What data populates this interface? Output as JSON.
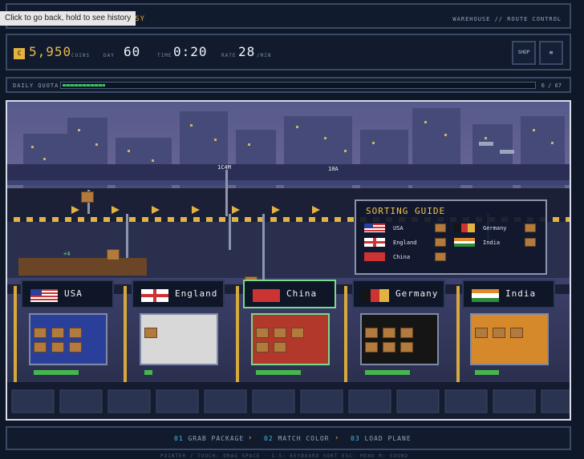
{
  "tooltip": "Click to go back, hold to see history",
  "brand": "RENSY",
  "breadcrumb": "WAREHOUSE // ROUTE CONTROL",
  "stats": {
    "coin_icon": "C",
    "coins": "5,950",
    "coins_label": "COINS",
    "day_label": "DAY",
    "day": "60",
    "time_label": "TIME",
    "time": "0:20",
    "rate_label": "RATE",
    "rate": "28",
    "rate_unit": "/MIN",
    "shop_label": "SHOP",
    "menu_label": "≡"
  },
  "quota": {
    "label": "DAILY QUOTA",
    "done": 6,
    "total": 67,
    "count_text": "6 / 67",
    "fraction": 0.0896
  },
  "scene": {
    "price_tags": [
      "1C4M",
      "10A"
    ],
    "sign": "+4",
    "guide": {
      "title": "SORTING GUIDE",
      "entries": [
        "USA",
        "England",
        "China",
        "Germany",
        "India"
      ]
    },
    "bins": [
      {
        "name": "USA",
        "color": "#2a3f9a",
        "packages": 6,
        "active": false
      },
      {
        "name": "England",
        "color": "#d8d8d8",
        "packages": 1,
        "active": false
      },
      {
        "name": "China",
        "color": "#b3382c",
        "packages": 5,
        "active": true
      },
      {
        "name": "Germany",
        "color": "#151515",
        "packages": 6,
        "active": false
      },
      {
        "name": "India",
        "color": "#d6892a",
        "packages": 3,
        "active": false
      }
    ]
  },
  "steps": [
    {
      "num": "01",
      "label": "GRAB PACKAGE"
    },
    {
      "num": "02",
      "label": "MATCH COLOR"
    },
    {
      "num": "03",
      "label": "LOAD PLANE"
    }
  ],
  "controls": "POINTER / TOUCH: DRAG   SPACE · 1-5: KEYBOARD SORT   ESC: MENU   M: SOUND"
}
